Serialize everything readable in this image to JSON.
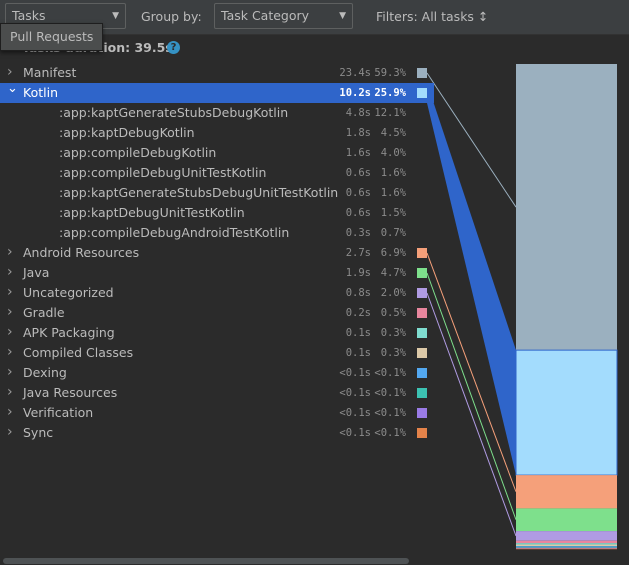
{
  "toolbar": {
    "view_combo": "Tasks",
    "group_by_label": "Group by:",
    "group_by_value": "Task Category",
    "filters_label": "Filters: All tasks ↕"
  },
  "tooltip": "Pull Requests",
  "duration": "Tasks duration: 39.5s",
  "categories": [
    {
      "name": "Manifest",
      "time": "23.4s",
      "pct": "59.3%",
      "color": "#9bb0bf",
      "expanded": false
    },
    {
      "name": "Kotlin",
      "time": "10.2s",
      "pct": "25.9%",
      "color": "#a3dcfd",
      "expanded": true,
      "selected": true,
      "children": [
        {
          "name": ":app:kaptGenerateStubsDebugKotlin",
          "time": "4.8s",
          "pct": "12.1%"
        },
        {
          "name": ":app:kaptDebugKotlin",
          "time": "1.8s",
          "pct": "4.5%"
        },
        {
          "name": ":app:compileDebugKotlin",
          "time": "1.6s",
          "pct": "4.0%"
        },
        {
          "name": ":app:compileDebugUnitTestKotlin",
          "time": "0.6s",
          "pct": "1.6%"
        },
        {
          "name": ":app:kaptGenerateStubsDebugUnitTestKotlin",
          "time": "0.6s",
          "pct": "1.6%"
        },
        {
          "name": ":app:kaptDebugUnitTestKotlin",
          "time": "0.6s",
          "pct": "1.5%"
        },
        {
          "name": ":app:compileDebugAndroidTestKotlin",
          "time": "0.3s",
          "pct": "0.7%"
        }
      ]
    },
    {
      "name": "Android Resources",
      "time": "2.7s",
      "pct": "6.9%",
      "color": "#f5a07a"
    },
    {
      "name": "Java",
      "time": "1.9s",
      "pct": "4.7%",
      "color": "#7ee08c"
    },
    {
      "name": "Uncategorized",
      "time": "0.8s",
      "pct": "2.0%",
      "color": "#b09be3"
    },
    {
      "name": "Gradle",
      "time": "0.2s",
      "pct": "0.5%",
      "color": "#e8869e"
    },
    {
      "name": "APK Packaging",
      "time": "0.1s",
      "pct": "0.3%",
      "color": "#7fdcd0"
    },
    {
      "name": "Compiled Classes",
      "time": "0.1s",
      "pct": "0.3%",
      "color": "#dcc9a8"
    },
    {
      "name": "Dexing",
      "time": "<0.1s",
      "pct": "<0.1%",
      "color": "#53a8f0"
    },
    {
      "name": "Java Resources",
      "time": "<0.1s",
      "pct": "<0.1%",
      "color": "#3cc2b2"
    },
    {
      "name": "Verification",
      "time": "<0.1s",
      "pct": "<0.1%",
      "color": "#9a7be6"
    },
    {
      "name": "Sync",
      "time": "<0.1s",
      "pct": "<0.1%",
      "color": "#e4834a"
    }
  ],
  "chart_data": {
    "type": "bar",
    "stacked": true,
    "categories": [
      "Manifest",
      "Kotlin",
      "Android Resources",
      "Java",
      "Uncategorized",
      "Gradle",
      "APK Packaging",
      "Compiled Classes",
      "Dexing",
      "Java Resources",
      "Verification",
      "Sync"
    ],
    "values": [
      59.3,
      25.9,
      6.9,
      4.7,
      2.0,
      0.5,
      0.3,
      0.3,
      0.05,
      0.05,
      0.05,
      0.05
    ],
    "colors": [
      "#9bb0bf",
      "#a3dcfd",
      "#f5a07a",
      "#7ee08c",
      "#b09be3",
      "#e8869e",
      "#7fdcd0",
      "#dcc9a8",
      "#53a8f0",
      "#3cc2b2",
      "#9a7be6",
      "#e4834a"
    ],
    "highlighted": "Kotlin",
    "highlight_color": "#2f65ca"
  }
}
